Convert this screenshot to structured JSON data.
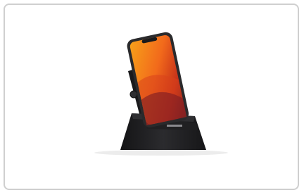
{
  "product_image": {
    "subject": "phone-stand-with-smartphone",
    "colors": {
      "frame_border": "#cfcfcf",
      "stand": "#1c1c1e",
      "stand_highlight": "#2e2e31",
      "phone_body": "#2a2a2c",
      "screen_orange": "#f26a1b",
      "screen_red": "#c8321a",
      "screen_dark": "#3a0d24",
      "shadow": "#e9e9e9"
    }
  }
}
